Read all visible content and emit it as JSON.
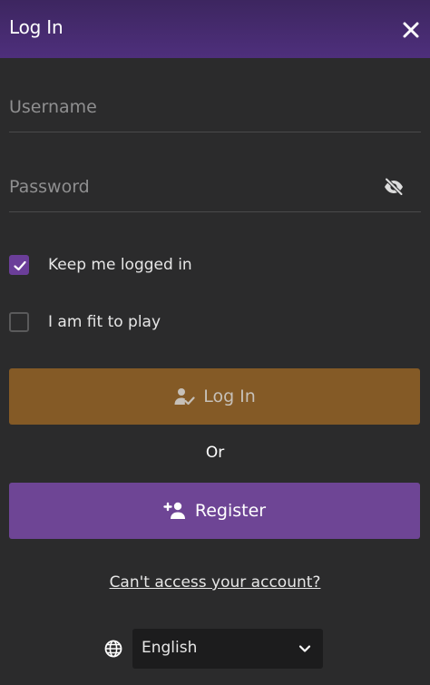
{
  "header": {
    "title": "Log In",
    "close_icon": "close-icon"
  },
  "form": {
    "username": {
      "placeholder": "Username",
      "value": ""
    },
    "password": {
      "placeholder": "Password",
      "value": "",
      "toggle_icon": "eye-off-icon"
    },
    "keep_logged_in": {
      "label": "Keep me logged in",
      "checked": true
    },
    "fit_to_play": {
      "label": "I am fit to play",
      "checked": false
    },
    "login_button": {
      "label": "Log In",
      "icon": "user-check-icon"
    },
    "or_text": "Or",
    "register_button": {
      "label": "Register",
      "icon": "add-user-icon"
    },
    "cant_access_link": "Can't access your account?"
  },
  "language": {
    "icon": "globe-icon",
    "selected": "English"
  },
  "colors": {
    "header": "#4e2f7c",
    "background": "#2b2b2c",
    "login_button": "#845a26",
    "register_button": "#6e4595",
    "checkbox_checked": "#6b3e99"
  }
}
